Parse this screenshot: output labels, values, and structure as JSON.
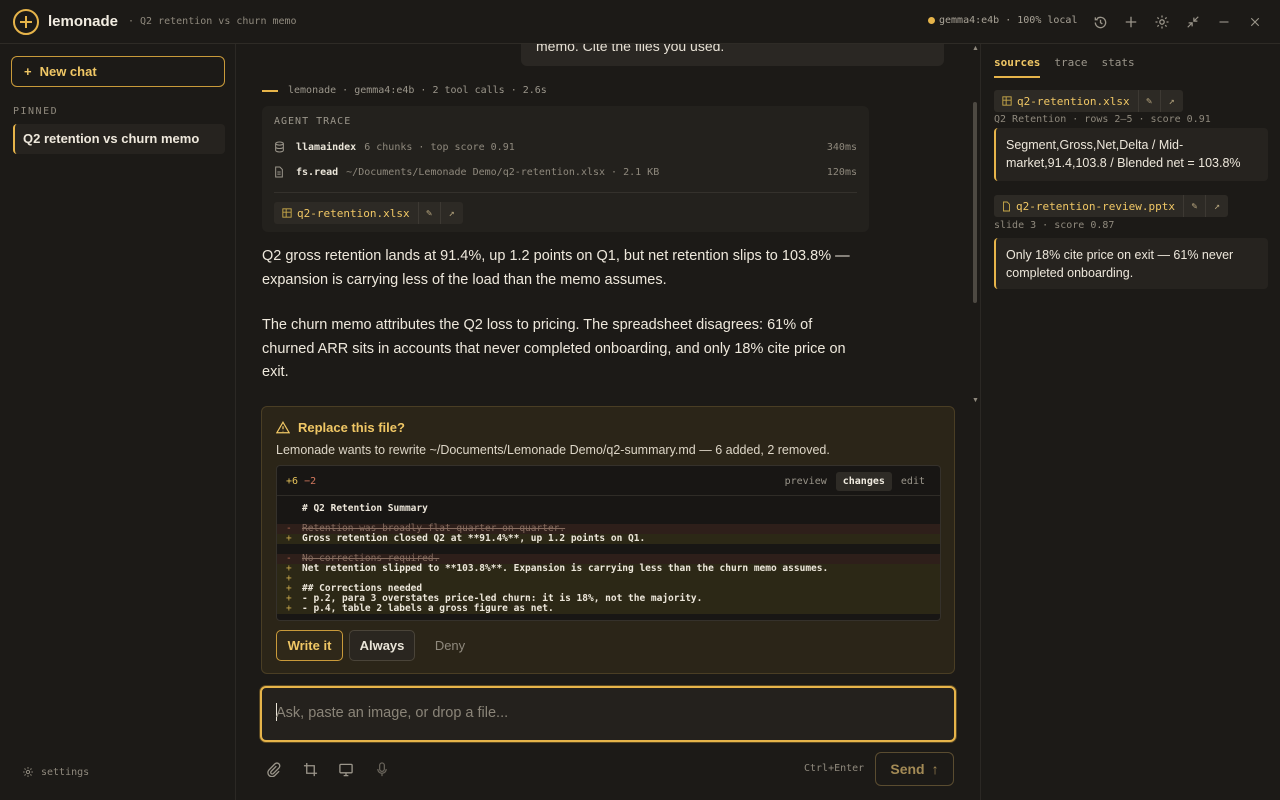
{
  "header": {
    "brand": "lemonade",
    "breadcrumb": "· Q2 retention vs churn memo",
    "model_status": "gemma4:e4b · 100% local"
  },
  "sidebar": {
    "new_chat": "New chat",
    "pinned_label": "PINNED",
    "pinned_items": [
      "Q2 retention vs churn memo"
    ],
    "settings": "settings"
  },
  "chat": {
    "previous_user_snippet": "memo. Cite the files you used.",
    "meta": {
      "author": "lemonade",
      "model": "gemma4:e4b",
      "tool_calls": "2 tool calls",
      "duration": "2.6s"
    },
    "trace": {
      "title": "AGENT TRACE",
      "rows": [
        {
          "tool": "llamaindex",
          "detail": "6 chunks · top score 0.91",
          "time": "340ms",
          "icon": "database-icon"
        },
        {
          "tool": "fs.read",
          "detail": "~/Documents/Lemonade Demo/q2-retention.xlsx · 2.1 KB",
          "time": "120ms",
          "icon": "file-icon"
        }
      ],
      "attachment": "q2-retention.xlsx"
    },
    "paragraphs": [
      "Q2 gross retention lands at 91.4%, up 1.2 points on Q1, but net retention slips to 103.8% — expansion is carrying less of the load than the memo assumes.",
      "The churn memo attributes the Q2 loss to pricing. The spreadsheet disagrees: 61% of churned ARR sits in accounts that never completed onboarding, and only 18% cite price on exit."
    ]
  },
  "permission": {
    "title": "Replace this file?",
    "description": "Lemonade wants to rewrite ~/Documents/Lemonade Demo/q2-summary.md — 6 added, 2 removed.",
    "diff": {
      "added": "+6",
      "removed": "−2",
      "tabs": [
        "preview",
        "changes",
        "edit"
      ],
      "active_tab": "changes",
      "lines": [
        {
          "kind": "context",
          "sign": "",
          "text": "# Q2 Retention Summary"
        },
        {
          "kind": "blank",
          "sign": "",
          "text": ""
        },
        {
          "kind": "minus",
          "sign": "-",
          "text": "Retention was broadly flat quarter on quarter."
        },
        {
          "kind": "plus",
          "sign": "+",
          "text": "Gross retention closed Q2 at **91.4%**, up 1.2 points on Q1."
        },
        {
          "kind": "blank",
          "sign": "",
          "text": ""
        },
        {
          "kind": "minus",
          "sign": "-",
          "text": "No corrections required."
        },
        {
          "kind": "plus",
          "sign": "+",
          "text": "Net retention slipped to **103.8%**. Expansion is carrying less than the churn memo assumes."
        },
        {
          "kind": "plus",
          "sign": "+",
          "text": ""
        },
        {
          "kind": "plus",
          "sign": "+",
          "text": "## Corrections needed"
        },
        {
          "kind": "plus",
          "sign": "+",
          "text": "- p.2, para 3 overstates price-led churn: it is 18%, not the majority."
        },
        {
          "kind": "plus",
          "sign": "+",
          "text": "- p.4, table 2 labels a gross figure as net."
        }
      ]
    },
    "buttons": {
      "write": "Write it",
      "always": "Always",
      "deny": "Deny"
    }
  },
  "composer": {
    "placeholder": "Ask, paste an image, or drop a file...",
    "shortcut": "Ctrl+Enter",
    "send": "Send"
  },
  "right_panel": {
    "tabs": [
      "sources",
      "trace",
      "stats"
    ],
    "active_tab": "sources",
    "sources": [
      {
        "file": "q2-retention.xlsx",
        "meta": "Q2 Retention · rows 2–5 · score 0.91",
        "quote": "Segment,Gross,Net,Delta / Mid-market,91.4,103.8 / Blended net = 103.8%"
      },
      {
        "file": "q2-retention-review.pptx",
        "meta": "slide 3 · score 0.87",
        "quote": "Only 18% cite price on exit — 61% never completed onboarding."
      }
    ]
  },
  "colors": {
    "accent": "#e6b44a",
    "background": "#1c1a17",
    "panel": "#23211d"
  }
}
